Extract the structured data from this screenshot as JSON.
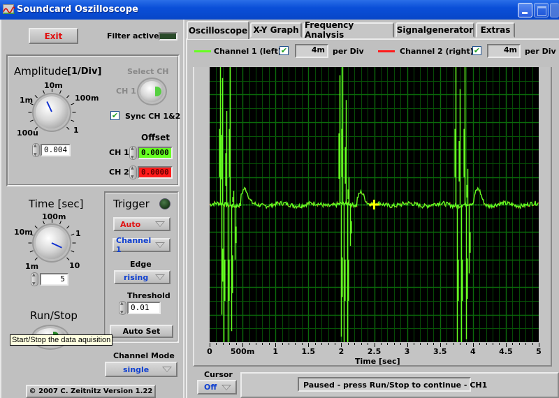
{
  "window": {
    "title": "Soundcard Oszilloscope",
    "buttons": [
      "minimize",
      "maximize",
      "close"
    ]
  },
  "left_panel": {
    "exit_label": "Exit",
    "filter_label": "Filter active",
    "amplitude": {
      "title": "Amplitude",
      "unit": "[1/Div]",
      "knob_labels": [
        "100u",
        "1m",
        "10m",
        "100m",
        "1"
      ],
      "value": "0.004",
      "select_ch_label": "Select CH",
      "ch_button_label": "CH 1",
      "sync_label": "Sync CH 1&2",
      "sync_checked": true,
      "offset_title": "Offset",
      "offsets": [
        {
          "label": "CH 1",
          "value": "0.0000",
          "color": "#66ff22"
        },
        {
          "label": "CH 2",
          "value": "0.0000",
          "color": "#ff1a1a"
        }
      ]
    },
    "time": {
      "title": "Time [sec]",
      "knob_labels": [
        "1m",
        "10m",
        "100m",
        "1",
        "10"
      ],
      "value": "5"
    },
    "trigger": {
      "title": "Trigger",
      "mode": "Auto",
      "source": "Channel 1",
      "edge_label": "Edge",
      "edge": "rising",
      "threshold_label": "Threshold",
      "threshold": "0.01",
      "autoset_label": "Auto Set"
    },
    "run_stop_label": "Run/Stop",
    "tooltip": "Start/Stop the data aquisition",
    "channel_mode_label": "Channel Mode",
    "channel_mode": "single",
    "copyright": "© 2007   C. Zeitnitz Version 1.22"
  },
  "tabs": [
    {
      "label": "Oscilloscope",
      "active": true
    },
    {
      "label": "X-Y Graph",
      "active": false
    },
    {
      "label": "Frequency Analysis",
      "active": false
    },
    {
      "label": "Signalgenerator",
      "active": false
    },
    {
      "label": "Extras",
      "active": false
    }
  ],
  "channels": [
    {
      "label": "Channel 1 (left)",
      "checked": true,
      "per_div": "4m",
      "per_div_label": "per Div",
      "color": "#66ff22"
    },
    {
      "label": "Channel 2 (right)",
      "checked": true,
      "per_div": "4m",
      "per_div_label": "per Div",
      "color": "#ff1a1a"
    }
  ],
  "cursor": {
    "label": "Cursor",
    "value": "Off"
  },
  "status": "Paused - press Run/Stop to continue - CH1",
  "chart_data": {
    "type": "line",
    "xlabel": "Time [sec]",
    "ylabel": "",
    "xlim": [
      0,
      5
    ],
    "ylim": [
      -5,
      5
    ],
    "x_tick_labels": [
      "0",
      "500m",
      "1",
      "1.5",
      "2",
      "2.5",
      "3",
      "3.5",
      "4",
      "4.5",
      "5"
    ],
    "x_tick_values": [
      0,
      0.5,
      1,
      1.5,
      2,
      2.5,
      3,
      3.5,
      4,
      4.5,
      5
    ],
    "grid": true,
    "trace_color": "#66ff22",
    "cursor_marker": {
      "x": 2.5,
      "y": 0,
      "color": "#ffff00"
    },
    "series": [
      {
        "name": "Channel 1 (left)",
        "bursts": [
          {
            "center": 0.3,
            "spikes": [
              {
                "x": 0.16,
                "hi": 5.0,
                "lo": -4.0
              },
              {
                "x": 0.19,
                "hi": 4.6,
                "lo": -5.0
              },
              {
                "x": 0.25,
                "hi": 3.4,
                "lo": -5.0
              },
              {
                "x": 0.31,
                "hi": 5.0,
                "lo": -4.6
              },
              {
                "x": 0.36,
                "hi": 0.5,
                "lo": -2.0
              }
            ]
          },
          {
            "center": 2.05,
            "spikes": [
              {
                "x": 1.97,
                "hi": 4.7,
                "lo": -4.8
              },
              {
                "x": 2.02,
                "hi": 5.0,
                "lo": -5.0
              },
              {
                "x": 2.07,
                "hi": 3.8,
                "lo": -5.0
              },
              {
                "x": 2.11,
                "hi": 1.0,
                "lo": -1.5
              }
            ]
          },
          {
            "center": 3.85,
            "spikes": [
              {
                "x": 3.74,
                "hi": 5.0,
                "lo": -5.0
              },
              {
                "x": 3.8,
                "hi": 4.2,
                "lo": -5.0
              },
              {
                "x": 3.87,
                "hi": 5.0,
                "lo": -4.9
              },
              {
                "x": 3.92,
                "hi": 1.3,
                "lo": -2.5
              }
            ]
          }
        ],
        "bumps": [
          {
            "x": 0.5,
            "peak": 0.55
          },
          {
            "x": 2.27,
            "peak": 0.5
          },
          {
            "x": 4.05,
            "peak": 0.55
          }
        ],
        "baseline": 0.0,
        "noise_amplitude": 0.08
      }
    ]
  }
}
